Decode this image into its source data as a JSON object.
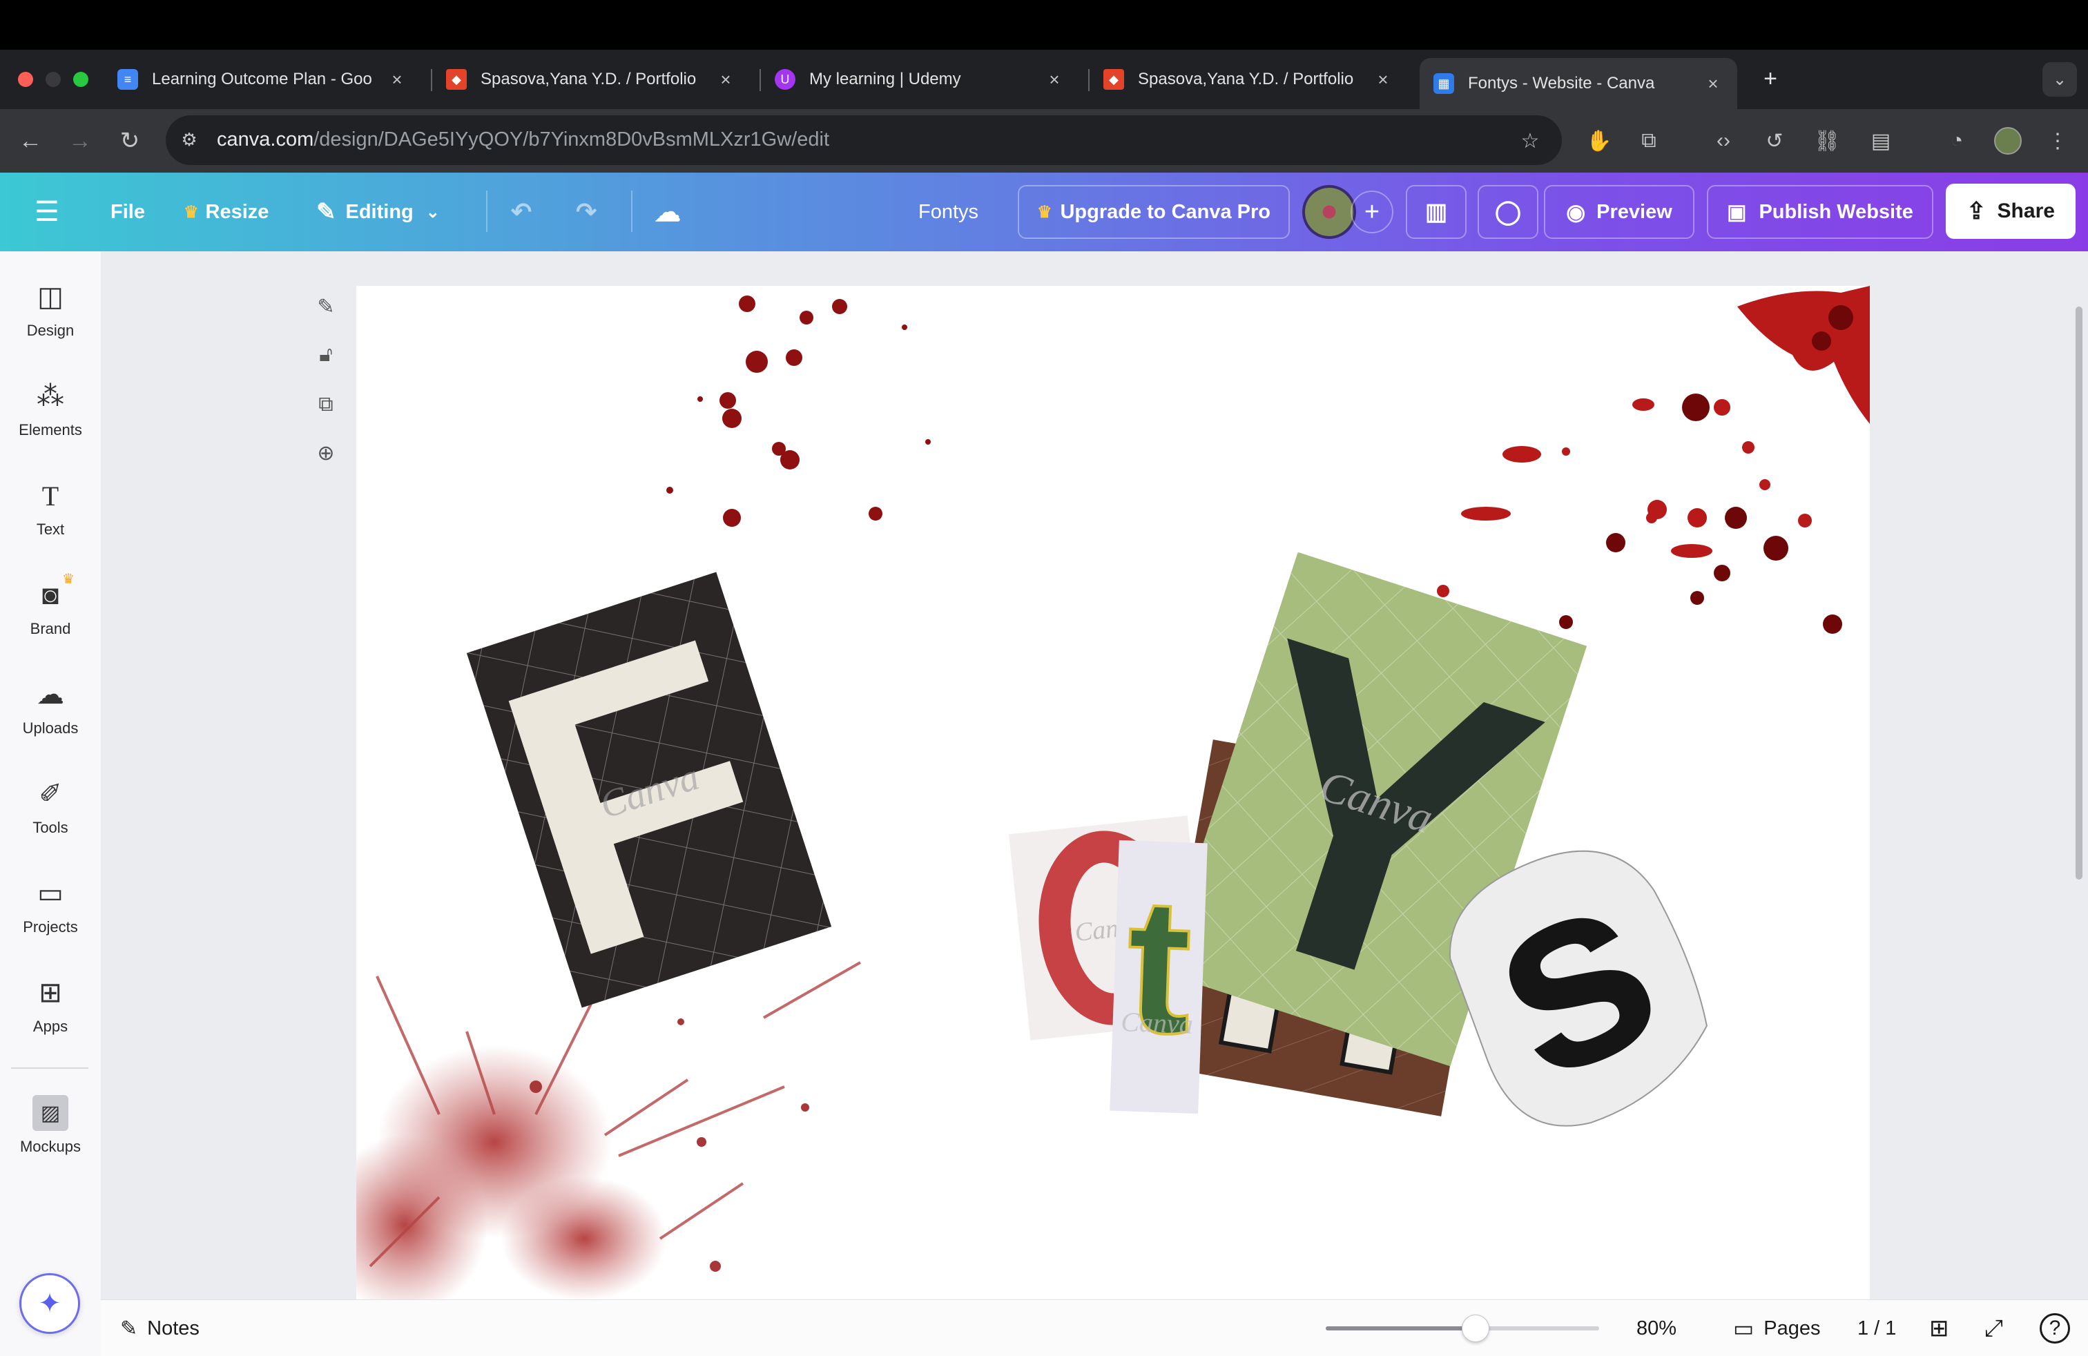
{
  "browser": {
    "tabs": [
      {
        "title": "Learning Outcome Plan - Goo",
        "icon": "google-docs-icon",
        "active": false
      },
      {
        "title": "Spasova,Yana Y.D. / Portfolio",
        "icon": "gitlab-icon",
        "active": false
      },
      {
        "title": "My learning | Udemy",
        "icon": "udemy-icon",
        "active": false
      },
      {
        "title": "Spasova,Yana Y.D. / Portfolio",
        "icon": "gitlab-icon",
        "active": false
      },
      {
        "title": "Fontys - Website - Canva",
        "icon": "canva-icon",
        "active": true
      }
    ],
    "url_host": "canva.com",
    "url_path": "/design/DAGe5IYyQOY/b7Yinxm8D0vBsmMLXzr1Gw/edit"
  },
  "header": {
    "file": "File",
    "resize": "Resize",
    "editing": "Editing",
    "design_title": "Fontys",
    "upgrade": "Upgrade to Canva Pro",
    "preview": "Preview",
    "publish": "Publish Website",
    "share": "Share"
  },
  "sidebar": {
    "items": [
      {
        "label": "Design",
        "icon": "design-icon"
      },
      {
        "label": "Elements",
        "icon": "elements-icon"
      },
      {
        "label": "Text",
        "icon": "text-icon"
      },
      {
        "label": "Brand",
        "icon": "brand-icon"
      },
      {
        "label": "Uploads",
        "icon": "uploads-icon"
      },
      {
        "label": "Tools",
        "icon": "tools-icon"
      },
      {
        "label": "Projects",
        "icon": "projects-icon"
      },
      {
        "label": "Apps",
        "icon": "apps-icon"
      },
      {
        "label": "Mockups",
        "icon": "mockups-icon"
      }
    ]
  },
  "canvas": {
    "letters": [
      "F",
      "o",
      "n",
      "t",
      "Y",
      "s"
    ],
    "watermark": "Canva"
  },
  "footer": {
    "notes": "Notes",
    "zoom_percent": 80,
    "zoom": "80%",
    "pages": "Pages",
    "page_count": "1 / 1"
  },
  "colors": {
    "header_start": "#3cc8d4",
    "header_end": "#8a3de6",
    "blood": "#9e1414"
  }
}
